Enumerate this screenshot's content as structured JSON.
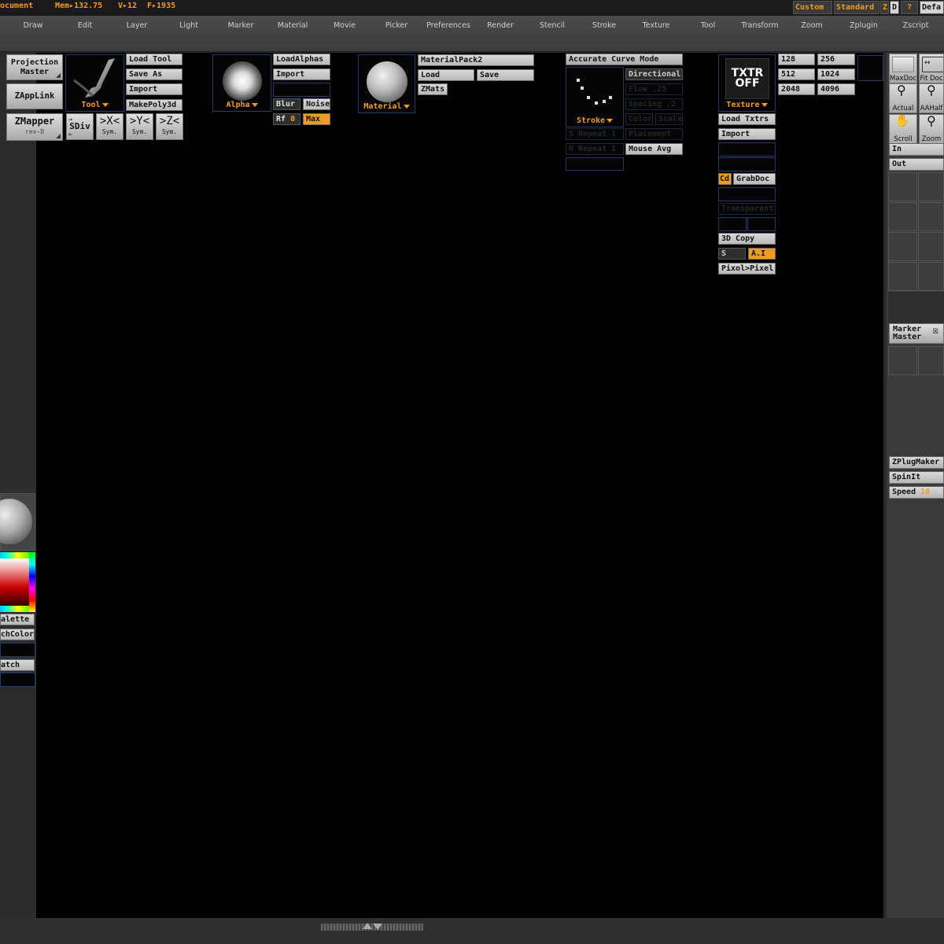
{
  "title_bar": {
    "document": "ocument",
    "mem_label": "Mem▸132.75",
    "verts": "V▸12",
    "faces": "F▸1935",
    "presets": [
      "Custom",
      "Standard",
      "Z",
      "D",
      "?",
      "Defa"
    ]
  },
  "menu": [
    "Draw",
    "Edit",
    "Layer",
    "Light",
    "Marker",
    "Material",
    "Movie",
    "Picker",
    "Preferences",
    "Render",
    "Stencil",
    "Stroke",
    "Texture",
    "Tool",
    "Transform",
    "Zoom",
    "Zplugin",
    "Zscript"
  ],
  "shelf": {
    "projection_master": [
      "Projection",
      "Master"
    ],
    "zapplink": "ZAppLink",
    "zmapper": "ZMapper",
    "zmapper_rev": "rev-D",
    "tool_label": "Tool",
    "load_tool": "Load Tool",
    "save_as": "Save As",
    "import": "Import",
    "makepoly3d": "MakePoly3d",
    "sdiv": "SDiv",
    "sym_x": ">X<",
    "sym_y": ">Y<",
    "sym_z": ">Z<",
    "sym": "Sym.",
    "alpha_label": "Alpha",
    "load_alphas": "LoadAlphas",
    "alpha_import": "Import",
    "blur": "Blur",
    "noise": "Noise",
    "rf_label": "Rf",
    "rf_value": "0",
    "max": "Max",
    "material_label": "Material",
    "material_pack": "MaterialPack2",
    "mat_load": "Load",
    "mat_save": "Save",
    "zmats": "ZMats",
    "accurate_curve_mode": "Accurate Curve Mode",
    "stroke_label": "Stroke",
    "directional": "Directional",
    "flow": "Flow .25",
    "spacing": "Spacing .2",
    "color": "Color",
    "scale": "Scale",
    "placement": "Placement",
    "s_repeat": "S Repeat 1",
    "n_repeat": "N Repeat 1",
    "mouse_avg": "Mouse Avg",
    "txtr_off_line1": "TXTR",
    "txtr_off_line2": "OFF",
    "texture_label": "Texture",
    "load_txtrs": "Load Txtrs",
    "tex_import": "Import",
    "cd": "Cd",
    "grabdoc": "GrabDoc",
    "transparent": "Transparent",
    "copy_3d": "3D Copy",
    "s_small": "S",
    "ai": "A.I",
    "pixol_pixel": "Pixol>Pixel",
    "sizes": [
      "128",
      "256",
      "512",
      "1024",
      "2048",
      "4096"
    ]
  },
  "right_tray": {
    "maxdoc": "MaxDoc",
    "fitdoc": "Fit Doc",
    "actual": "Actual",
    "aahalf": "AAHalf",
    "scroll": "Scroll",
    "zoom": "Zoom",
    "in": "In",
    "out": "Out",
    "marker_master": [
      "Marker",
      "Master"
    ],
    "zplugmaker": "ZPlugMaker",
    "spinit": "SpinIt",
    "speed_label": "Speed",
    "speed_value": "10"
  },
  "left_tray": {
    "palette": "alette",
    "switch_color": "chColor",
    "watch": "atch"
  },
  "colors": {
    "accent": "#f29b1e",
    "panel_border": "#1f3a63",
    "canvas": "#000000"
  }
}
